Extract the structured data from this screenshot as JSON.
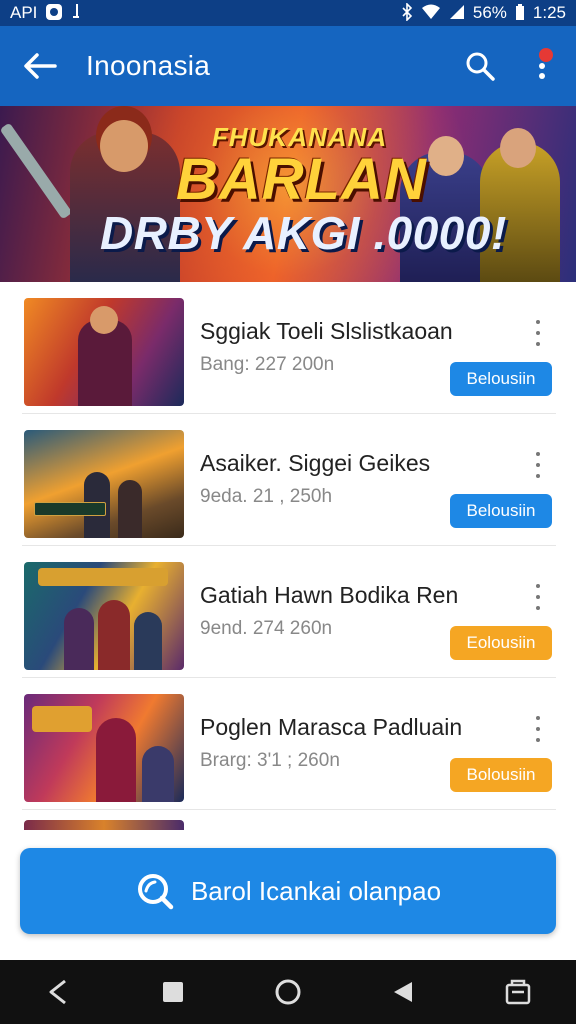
{
  "status_bar": {
    "left_text": "API",
    "battery": "56%",
    "time": "1:25",
    "icons": [
      "app-icon",
      "signal-indicator-icon",
      "bluetooth-icon",
      "wifi-icon",
      "cell-signal-icon",
      "battery-icon"
    ]
  },
  "app_bar": {
    "title": "Inoonasia",
    "icons": [
      "back-arrow-icon",
      "search-icon",
      "more-vert-icon"
    ],
    "notification_color": "#e53935"
  },
  "banner": {
    "line1": "FHUKANANA",
    "line2": "BARLAN",
    "line3": "DRBY AKGI .0000!"
  },
  "list": {
    "items": [
      {
        "title": "Sggiak Toeli Slslistkaoan",
        "subtitle": "Bang: 227 200n",
        "button": "Belousiin",
        "button_color": "#1e88e5",
        "thumb_colors": [
          "#f08a24",
          "#7a2b6a",
          "#1c2a5a"
        ]
      },
      {
        "title": "Asaiker. Siggei Geikes",
        "subtitle": "9eda. 21 , 250h",
        "button": "Belousiin",
        "button_color": "#1e88e5",
        "thumb_colors": [
          "#2a5a7a",
          "#f0a030",
          "#3a2a1a"
        ]
      },
      {
        "title": "Gatiah Hawn Bodika Ren",
        "subtitle": "9end. 274 260n",
        "button": "Eolousiin",
        "button_color": "#f5a623",
        "thumb_colors": [
          "#1a6a6a",
          "#e8b030",
          "#5a2a6a"
        ]
      },
      {
        "title": "Poglen Marasca Padluain",
        "subtitle": "Brarg: 3'1 ; 260n",
        "button": "Bolousiin",
        "button_color": "#f5a623",
        "thumb_colors": [
          "#6a2a7a",
          "#f07a30",
          "#1a2a5a"
        ]
      }
    ]
  },
  "cta": {
    "label": "Barol Icankai olanpao",
    "icon": "search-icon"
  },
  "nav_bar": {
    "icons": [
      "back-triangle-icon",
      "square-icon",
      "home-circle-icon",
      "play-reverse-icon",
      "recents-icon"
    ]
  },
  "colors": {
    "primary": "#1565c0",
    "status_bar": "#0d3f86",
    "accent_blue": "#1e88e5",
    "accent_orange": "#f5a623"
  }
}
